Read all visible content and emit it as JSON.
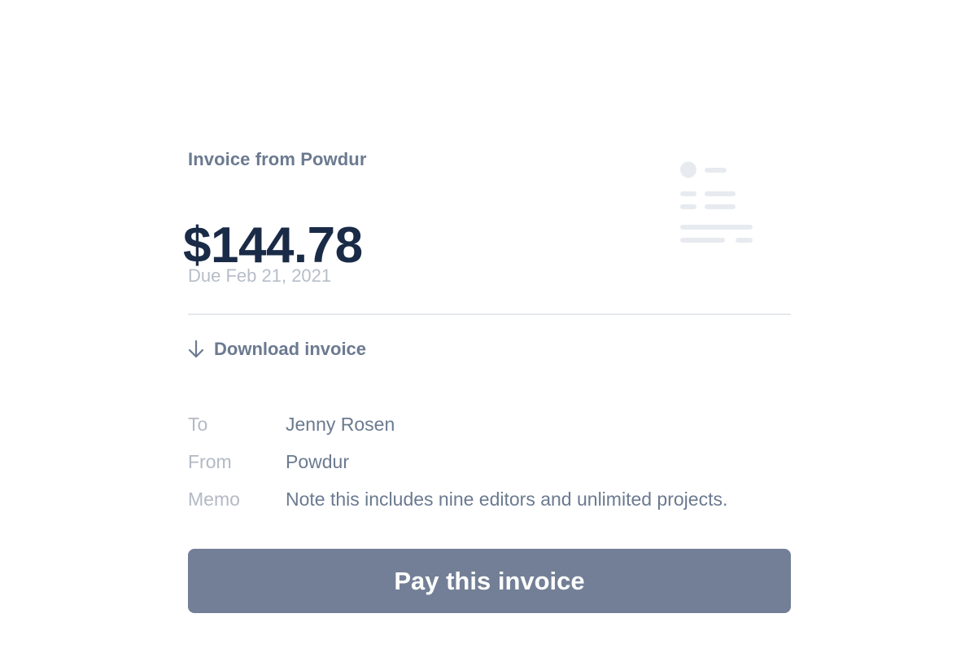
{
  "invoice": {
    "title": "Invoice from Powdur",
    "amount": "$144.78",
    "due": "Due Feb 21, 2021"
  },
  "actions": {
    "download_label": "Download invoice",
    "pay_label": "Pay this invoice"
  },
  "details": [
    {
      "label": "To",
      "value": "Jenny Rosen"
    },
    {
      "label": "From",
      "value": "Powdur"
    },
    {
      "label": "Memo",
      "value": "Note this includes nine editors and unlimited projects."
    }
  ],
  "icons": {
    "download": "arrow-down-icon",
    "illustration": "document-illustration-icon"
  },
  "colors": {
    "primary_text": "#1a2b47",
    "secondary_text": "#6b7a90",
    "muted_text": "#b3bac5",
    "button": "#737f96",
    "divider": "#e6e9ee"
  }
}
